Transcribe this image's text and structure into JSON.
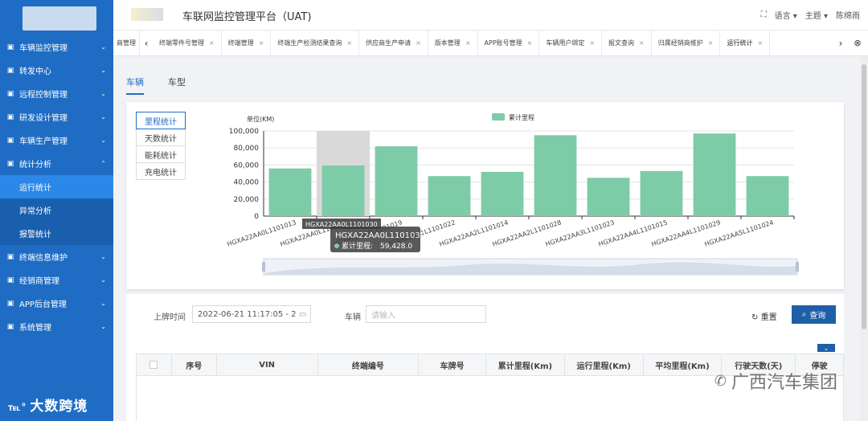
{
  "sidebar": {
    "items": [
      {
        "label": "车辆监控管理",
        "icon": "monitor-icon"
      },
      {
        "label": "转发中心",
        "icon": "forward-icon"
      },
      {
        "label": "远程控制管理",
        "icon": "remote-icon"
      },
      {
        "label": "研发设计管理",
        "icon": "design-icon"
      },
      {
        "label": "车辆生产管理",
        "icon": "car-icon"
      },
      {
        "label": "统计分析",
        "icon": "stats-icon"
      },
      {
        "label": "运行统计",
        "sub": true,
        "active": true
      },
      {
        "label": "异常分析",
        "sub": true
      },
      {
        "label": "报警统计",
        "sub": true
      },
      {
        "label": "终端信息维护",
        "icon": "terminal-icon"
      },
      {
        "label": "经销商管理",
        "icon": "dealer-icon"
      },
      {
        "label": "APP后台管理",
        "icon": "app-icon"
      },
      {
        "label": "系统管理",
        "icon": "system-icon"
      }
    ],
    "footer": "大数跨境"
  },
  "header": {
    "title": "车联网监控管理平台（UAT)",
    "fullscreen": "⛶",
    "language": "语言",
    "theme": "主题",
    "user": "陈绵雨"
  },
  "tabs": [
    {
      "label": "商管理"
    },
    {
      "label": "终端零件号管理"
    },
    {
      "label": "终端管理"
    },
    {
      "label": "终端生产检测结果查询"
    },
    {
      "label": "供应商生产申请"
    },
    {
      "label": "版本管理"
    },
    {
      "label": "APP账号管理"
    },
    {
      "label": "车辆用户绑定"
    },
    {
      "label": "报文查询"
    },
    {
      "label": "归属经销商维护"
    },
    {
      "label": "运行统计",
      "active": true
    }
  ],
  "subtabs": {
    "vehicle": "车辆",
    "model": "车型"
  },
  "stat_buttons": [
    "里程统计",
    "天数统计",
    "能耗统计",
    "充电统计"
  ],
  "colors": {
    "bar": "#7ecba8",
    "accent": "#1f6cc4",
    "highlight": "#d9d9d9"
  },
  "chart_data": {
    "type": "bar",
    "unit_label": "单位(KM)",
    "legend": "累计里程",
    "categories": [
      "HGXA22AA0L1101013",
      "HGXA22AA0L1101030",
      "HGXA22AA1L1101019",
      "HGXA22AA1L1101022",
      "HGXA22AA2L1101014",
      "HGXA22AA2L1101028",
      "HGXA22AA3L1101023",
      "HGXA22AA4L1101015",
      "HGXA22AA4L1101029",
      "HGXA22AA5L1101024"
    ],
    "series": [
      {
        "name": "累计里程",
        "values": [
          56000,
          59428,
          82000,
          47000,
          52000,
          95000,
          45000,
          53000,
          97000,
          47000
        ]
      }
    ],
    "ylim": [
      0,
      100000
    ],
    "yticks": [
      "0",
      "20,000",
      "40,000",
      "60,000",
      "80,000",
      "100,000"
    ],
    "highlight_index": 1,
    "tooltip": {
      "title": "HGXA22AA0L1101030",
      "label": "累计里程:",
      "value": "59,428.0"
    }
  },
  "query": {
    "time_label": "上牌时间",
    "time_value": "2022-06-21 11:17:05 - 2022",
    "vehicle_label": "车辆",
    "vehicle_placeholder": "请输入",
    "reset": "重置",
    "search": "查询"
  },
  "table": {
    "columns": [
      "序号",
      "VIN",
      "终端编号",
      "车牌号",
      "累计里程(Km)",
      "运行里程(Km)",
      "平均里程(Km)",
      "行驶天数(天)",
      "停驶"
    ]
  },
  "watermark": "广西汽车集团"
}
